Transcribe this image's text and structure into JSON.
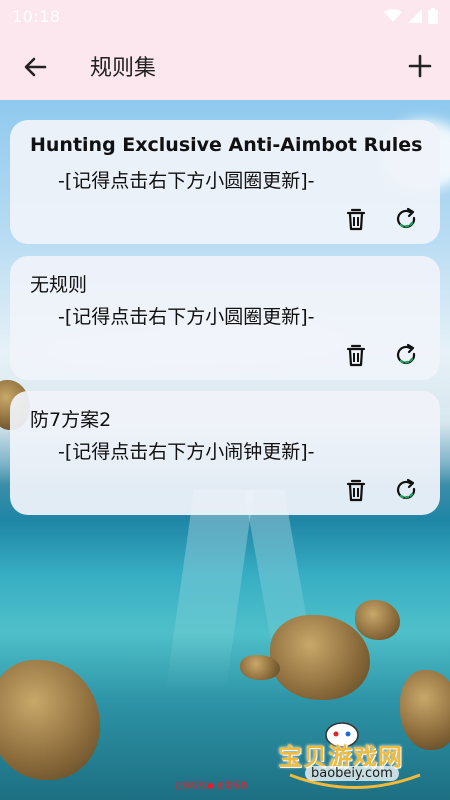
{
  "status_bar": {
    "time": "10:18"
  },
  "app_bar": {
    "title": "规则集",
    "back_icon": "arrow-left-icon",
    "add_icon": "plus-icon"
  },
  "cards": [
    {
      "title": "Hunting Exclusive Anti-Aimbot Rules",
      "subtitle": "-[记得点击右下方小圆圈更新]-"
    },
    {
      "title": "无规则",
      "subtitle": "-[记得点击右下方小圆圈更新]-"
    },
    {
      "title": "防7方案2",
      "subtitle": "-[记得点击右下方小闹钟更新]-"
    }
  ],
  "card_actions": {
    "delete_icon": "trash-icon",
    "refresh_icon": "refresh-icon"
  },
  "watermark": {
    "brand": "宝贝游戏网",
    "domain": "baobeiy.com",
    "footer": "正规版权● 正常授权"
  },
  "colors": {
    "bar": "#fde7ee",
    "card": "#f0f3fa",
    "refresh_accent": "#1aa35a"
  }
}
